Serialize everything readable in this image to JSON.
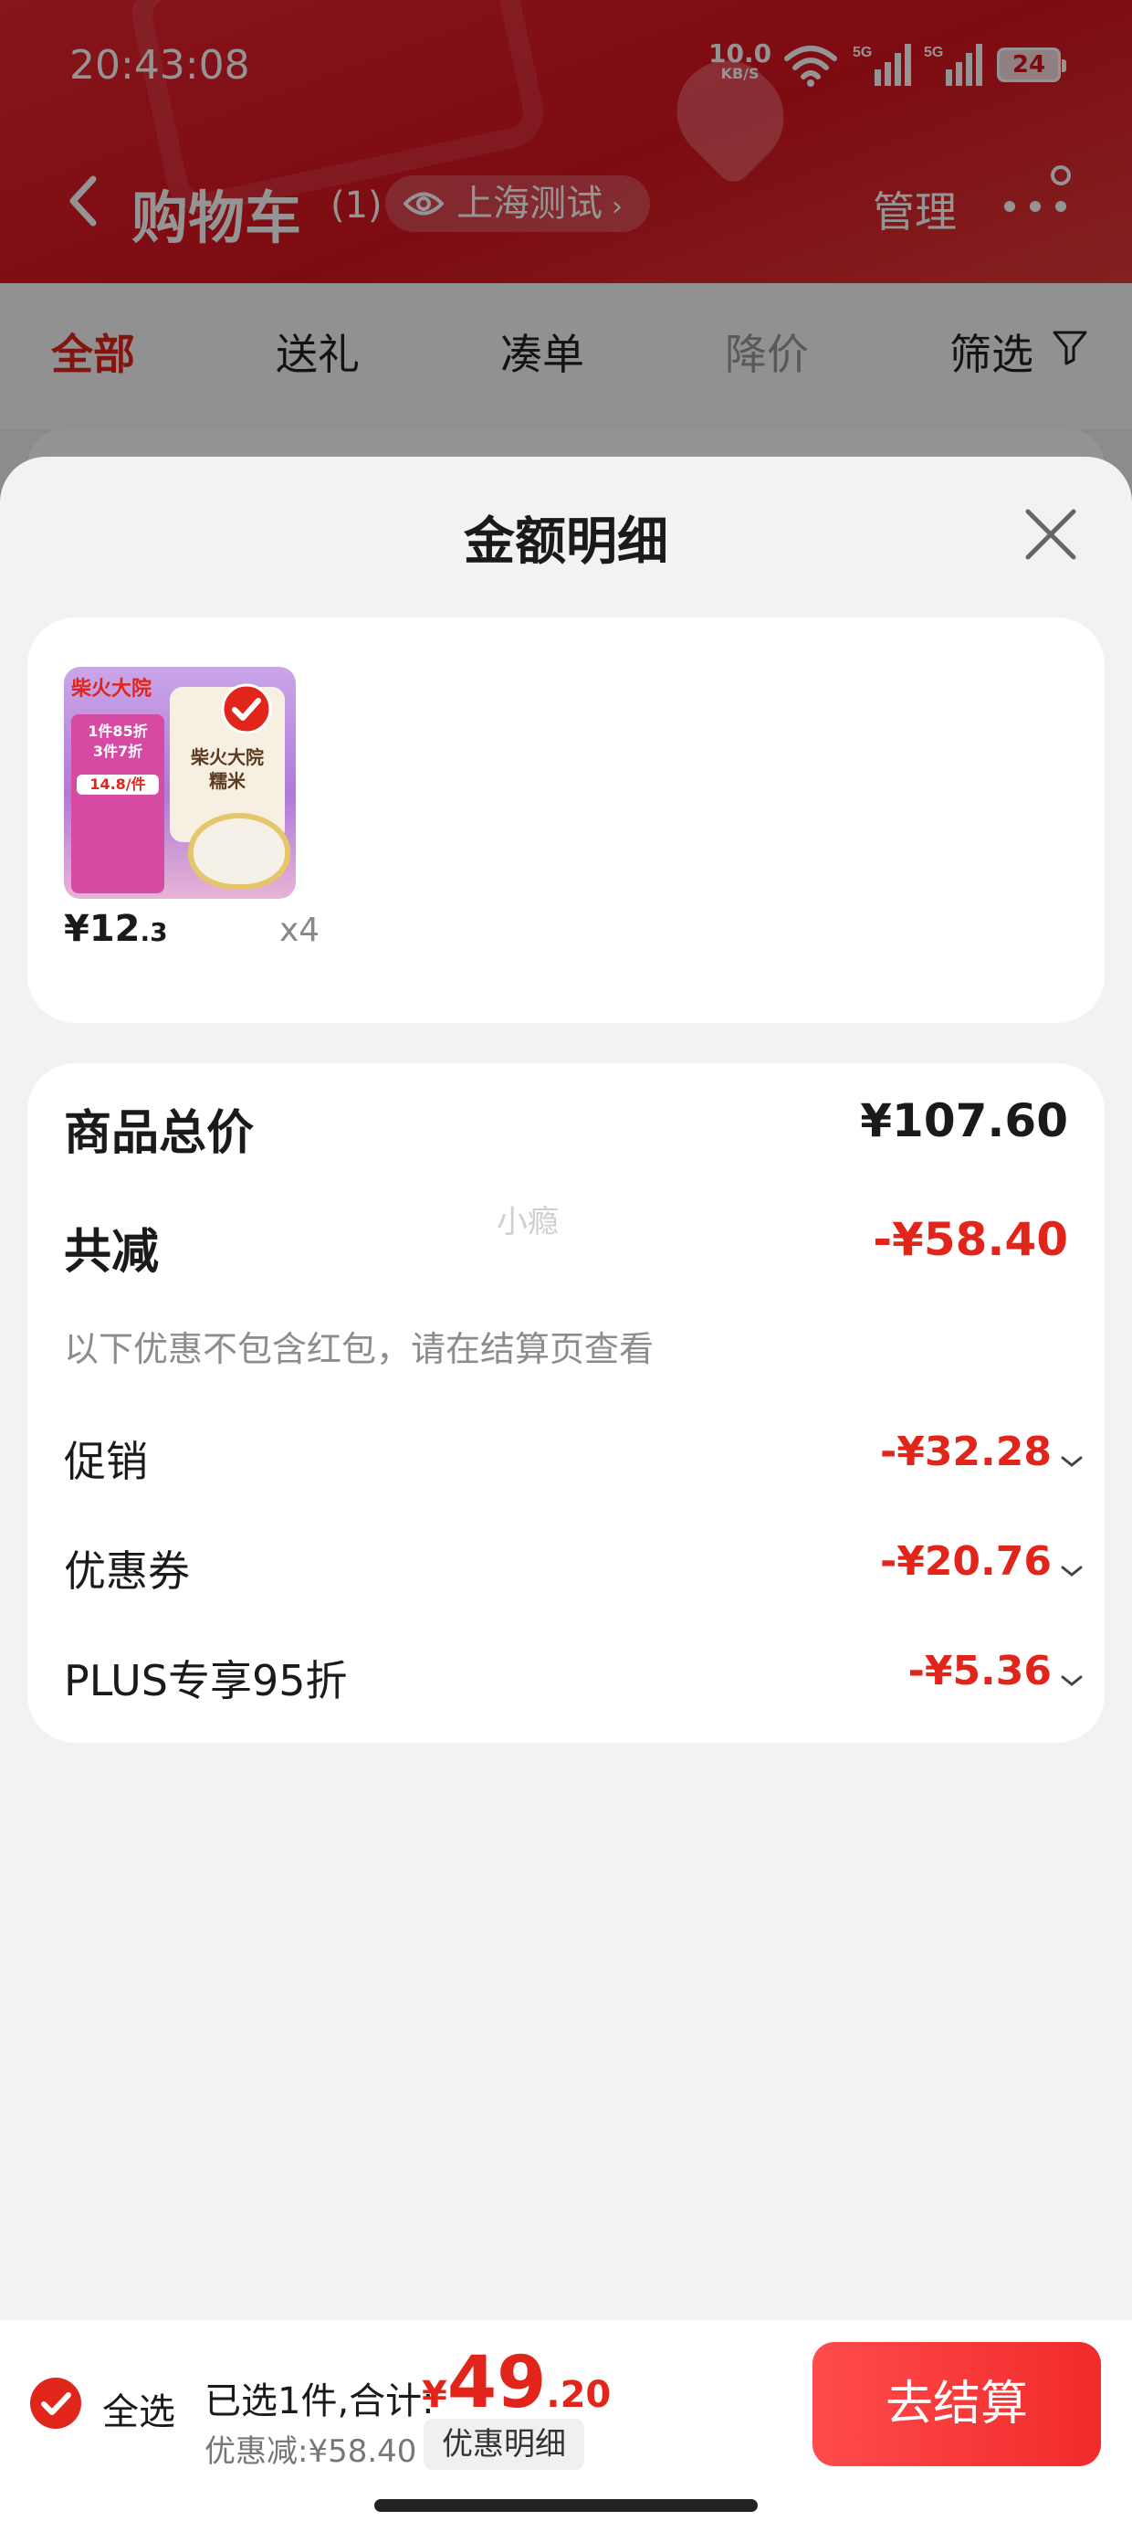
{
  "status_bar": {
    "time": "20:43:08",
    "net_speed": "10.0",
    "net_unit": "KB/S",
    "sig1_label": "5G",
    "sig2_label": "5G",
    "battery": "24"
  },
  "header": {
    "title": "购物车",
    "count": "(1)",
    "location": "上海测试",
    "manage": "管理"
  },
  "tabs": [
    {
      "label": "全部",
      "state": "active"
    },
    {
      "label": "送礼",
      "state": "normal"
    },
    {
      "label": "凑单",
      "state": "normal"
    },
    {
      "label": "降价",
      "state": "muted"
    },
    {
      "label": "筛选",
      "state": "normal"
    }
  ],
  "sheet": {
    "title": "金额明细",
    "product": {
      "thumb_brand": "柴火大院",
      "thumb_bag_line1": "柴火大院",
      "thumb_bag_line2": "糯米",
      "thumb_promo_line1": "1件85折",
      "thumb_promo_line2": "3件7折",
      "thumb_promo_price": "14.8/件",
      "price_int": "¥12",
      "price_dec": ".3",
      "quantity": "x4"
    },
    "summary": {
      "total_label": "商品总价",
      "total_value": "¥107.60",
      "watermark": "小瘾",
      "reduce_label": "共减",
      "reduce_value": "-¥58.40",
      "note": "以下优惠不包含红包，请在结算页查看",
      "items": [
        {
          "label": "促销",
          "value": "-¥32.28"
        },
        {
          "label": "优惠券",
          "value": "-¥20.76"
        },
        {
          "label": "PLUS专享95折",
          "value": "-¥5.36"
        }
      ]
    }
  },
  "bottom_bar": {
    "select_all": "全选",
    "selected_text": "已选1件,合计:",
    "total_symbol": "¥",
    "total_int": "49",
    "total_dec": ".20",
    "saving_text": "优惠减:¥58.40",
    "detail_chip": "优惠明细",
    "checkout": "去结算"
  },
  "colors": {
    "accent": "#e1251b",
    "header_red": "#d8141f",
    "checkout_gradient_start": "#ff4b4b",
    "checkout_gradient_end": "#f12a2a"
  }
}
